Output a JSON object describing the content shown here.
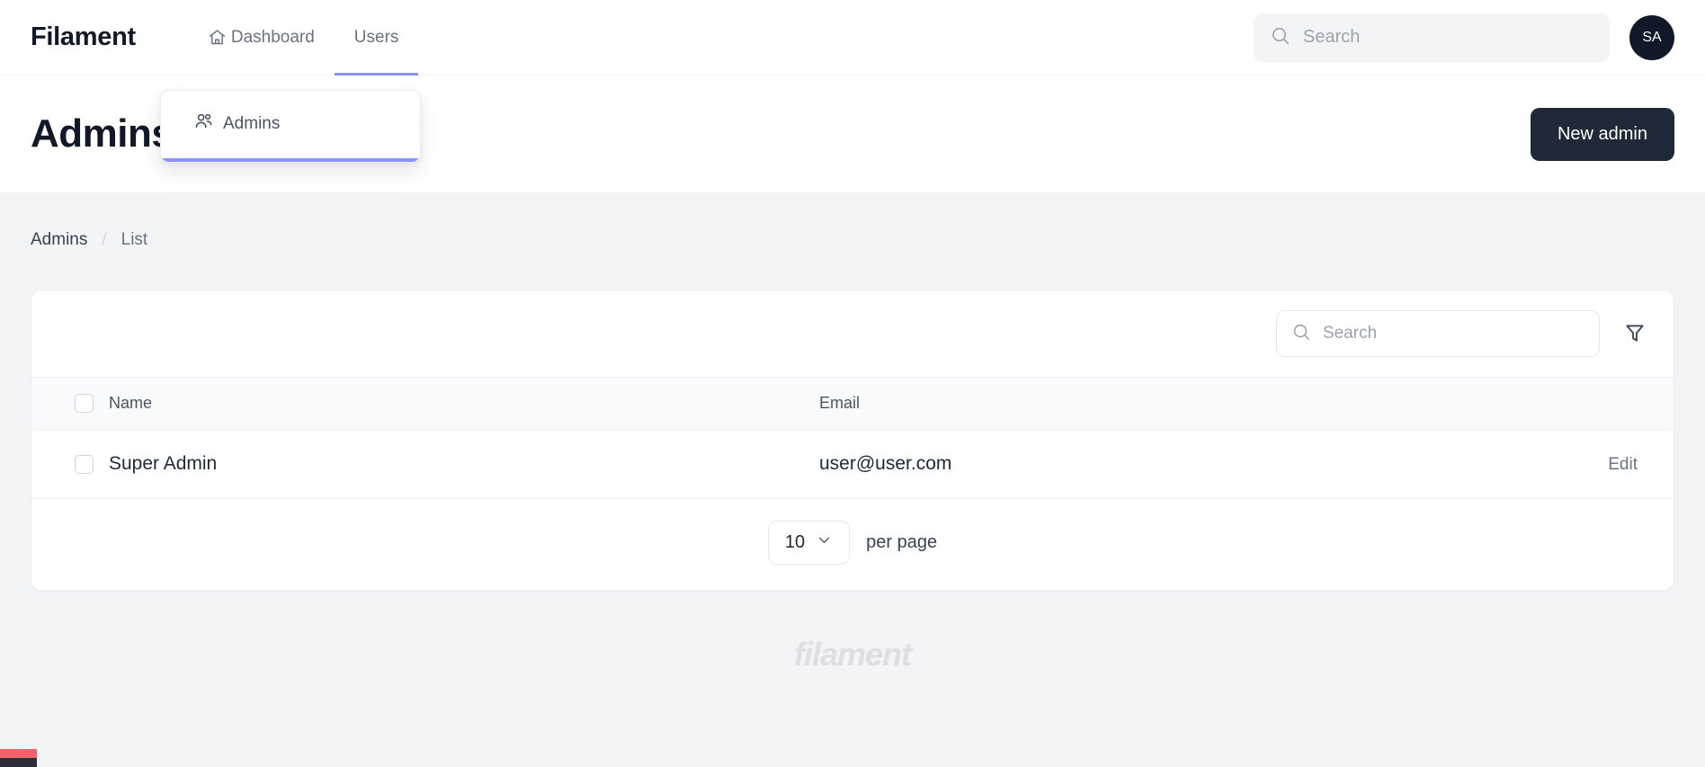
{
  "app": {
    "brand": "Filament"
  },
  "topnav": {
    "items": [
      {
        "label": "Dashboard",
        "icon": "home-icon",
        "active": false
      },
      {
        "label": "Users",
        "icon": "",
        "active": true
      }
    ],
    "search": {
      "placeholder": "Search",
      "value": "",
      "icon": "search-icon"
    },
    "avatar": {
      "initials": "SA"
    }
  },
  "dropdown": {
    "visible": true,
    "items": [
      {
        "label": "Admins",
        "icon": "users-group-icon"
      }
    ],
    "accent_color": "#8b93f8"
  },
  "page": {
    "title": "Admins",
    "primary_action": "New admin"
  },
  "breadcrumb": {
    "root": "Admins",
    "separator": "/",
    "current": "List"
  },
  "table": {
    "search": {
      "placeholder": "Search",
      "value": "",
      "icon": "search-icon"
    },
    "filter_icon": "funnel-icon",
    "columns": [
      "Name",
      "Email"
    ],
    "rows": [
      {
        "name": "Super Admin",
        "email": "user@user.com",
        "action": "Edit"
      }
    ],
    "pagination": {
      "per_page_value": "10",
      "per_page_label": "per page",
      "chevron": "chevron-down-icon"
    }
  },
  "footer": {
    "logo_text": "filament"
  },
  "theme": {
    "accent": "#8b93f8",
    "primary_button": "#1f2937",
    "page_background": "#f3f4f6",
    "debug_red": "#f4606c",
    "debug_dark": "#2b2f3a"
  }
}
